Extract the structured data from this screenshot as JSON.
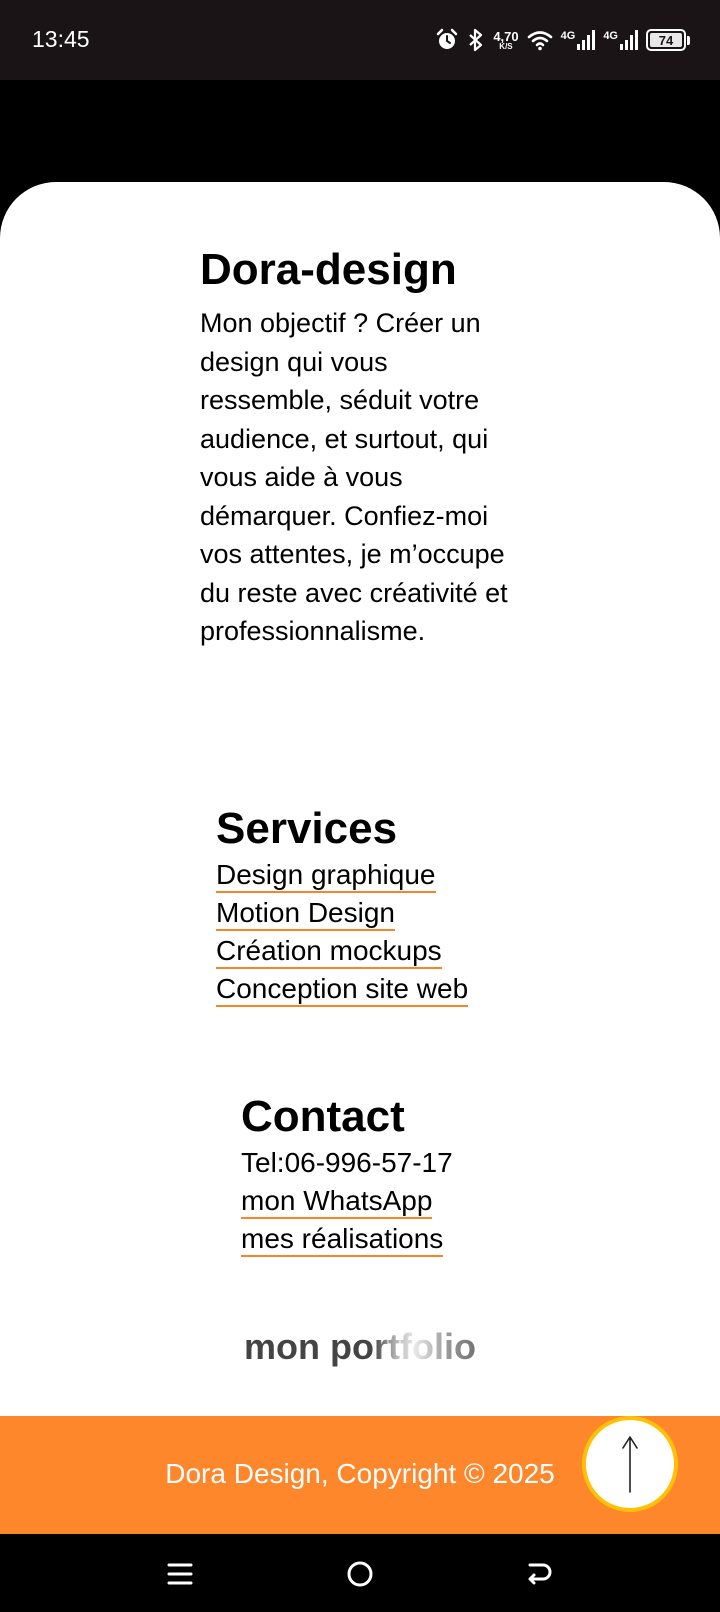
{
  "status_bar": {
    "time": "13:45",
    "net_speed_value": "4,70",
    "net_speed_unit": "K/S",
    "signal1_label": "4G",
    "signal2_label": "4G",
    "battery_level": "74"
  },
  "about": {
    "title": "Dora-design",
    "text": "Mon objectif ? Créer un design qui vous ressemble, séduit votre audience, et surtout, qui vous aide à vous démarquer. Confiez-moi vos attentes, je m’occupe du reste avec créativité et professionnalisme."
  },
  "services": {
    "title": "Services",
    "items": [
      "Design graphique",
      "Motion Design",
      "Création mockups",
      "Conception site web"
    ]
  },
  "contact": {
    "title": "Contact",
    "phone": "Tel:06-996-57-17",
    "whatsapp": "mon WhatsApp",
    "realisations": "mes réalisations"
  },
  "portfolio": {
    "label": "mon portfolio"
  },
  "footer": {
    "copyright": "Dora Design, Copyright © 2025"
  },
  "colors": {
    "accent": "#fe862b",
    "underline": "#f5842a",
    "button_ring": "#ffc107"
  },
  "icons": {
    "status": [
      "alarm-icon",
      "bluetooth-icon",
      "wifi-icon",
      "signal-icon",
      "battery-icon"
    ],
    "scroll_top": "arrow-up-icon",
    "nav": [
      "menu-icon",
      "home-icon",
      "back-icon"
    ]
  }
}
